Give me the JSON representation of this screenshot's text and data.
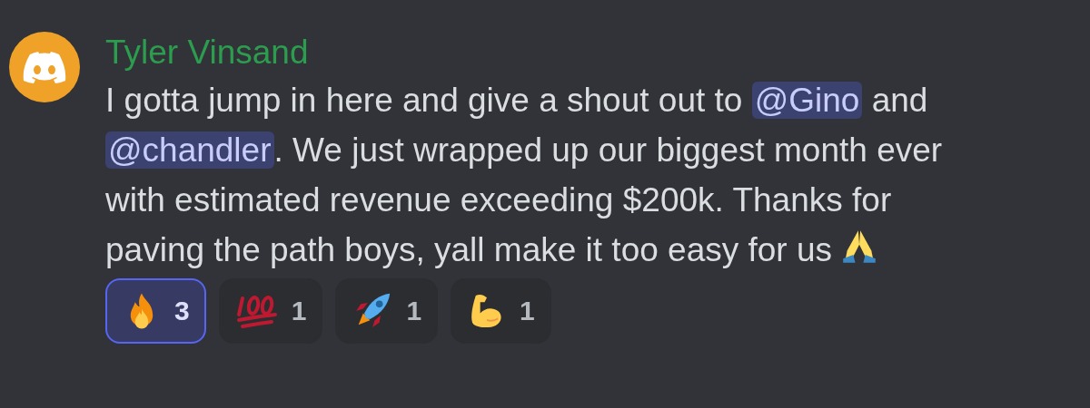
{
  "message": {
    "author": "Tyler Vinsand",
    "lines": [
      [
        {
          "kind": "text",
          "text": "I gotta jump in here and give a shout out to "
        },
        {
          "kind": "mention",
          "text": "@Gino"
        },
        {
          "kind": "text",
          "text": " and"
        }
      ],
      [
        {
          "kind": "mention",
          "text": "@chandler"
        },
        {
          "kind": "text",
          "text": ". We just wrapped up our biggest month ever"
        }
      ],
      [
        {
          "kind": "text",
          "text": "with estimated revenue exceeding $200k. Thanks for"
        }
      ],
      [
        {
          "kind": "text",
          "text": "paving the path boys, yall make it too easy for us "
        },
        {
          "kind": "pray_emoji"
        }
      ]
    ],
    "reactions": [
      {
        "kind": "fire",
        "count": "3",
        "selected": true
      },
      {
        "kind": "hundred",
        "count": "1",
        "selected": false
      },
      {
        "kind": "rocket",
        "count": "1",
        "selected": false
      },
      {
        "kind": "muscle",
        "count": "1",
        "selected": false
      }
    ]
  }
}
